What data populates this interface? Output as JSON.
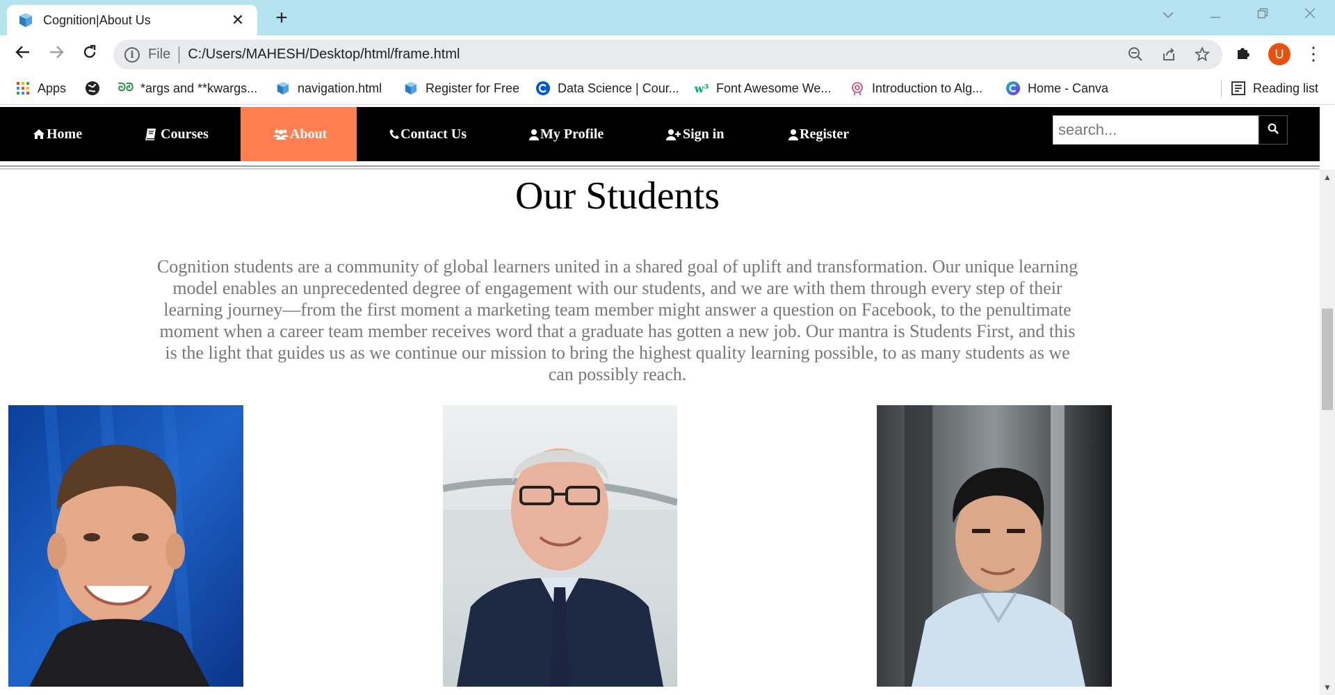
{
  "browser": {
    "tab_title": "Cognition|About Us",
    "new_tab": "+",
    "url_scheme": "File",
    "url": "C:/Users/MAHESH/Desktop/html/frame.html",
    "avatar_letter": "U",
    "bookmarks": [
      {
        "label": "Apps",
        "icon": "apps-grid-icon"
      },
      {
        "label": "",
        "icon": "globe-icon"
      },
      {
        "label": "*args and **kwargs...",
        "icon": "geeksforgeeks-icon"
      },
      {
        "label": "navigation.html",
        "icon": "html-file-icon"
      },
      {
        "label": "Register for Free",
        "icon": "html-file-icon"
      },
      {
        "label": "Data Science | Cour...",
        "icon": "coursera-icon"
      },
      {
        "label": "Font Awesome We...",
        "icon": "w3schools-icon"
      },
      {
        "label": "Introduction to Alg...",
        "icon": "algorithm-icon"
      },
      {
        "label": "Home - Canva",
        "icon": "canva-icon"
      }
    ],
    "reading_list": "Reading list"
  },
  "site_nav": {
    "items": [
      {
        "label": "Home",
        "icon": "home-icon",
        "active": false
      },
      {
        "label": "Courses",
        "icon": "book-icon",
        "active": false
      },
      {
        "label": "About",
        "icon": "users-icon",
        "active": true
      },
      {
        "label": "Contact Us",
        "icon": "phone-icon",
        "active": false
      },
      {
        "label": "My Profile",
        "icon": "user-icon",
        "active": false
      },
      {
        "label": "Sign in",
        "icon": "user-plus-icon",
        "active": false
      },
      {
        "label": "Register",
        "icon": "user-icon",
        "active": false
      }
    ],
    "search_placeholder": "search...",
    "active_color": "#ff7f50"
  },
  "main": {
    "heading": "Our Students",
    "paragraph": "Cognition students are a community of global learners united in a shared goal of uplift and transformation. Our unique learning model enables an unprecedented degree of engagement with our students, and we are with them through every step of their learning journey—from the first moment a marketing team member might answer a question on Facebook, to the penultimate moment when a career team member receives word that a graduate has gotten a new job. Our mantra is Students First, and this is the light that guides us as we continue our mission to bring the highest quality learning possible, to as many students as we can possibly reach.",
    "photos": [
      "student-photo-1",
      "student-photo-2",
      "student-photo-3"
    ]
  }
}
